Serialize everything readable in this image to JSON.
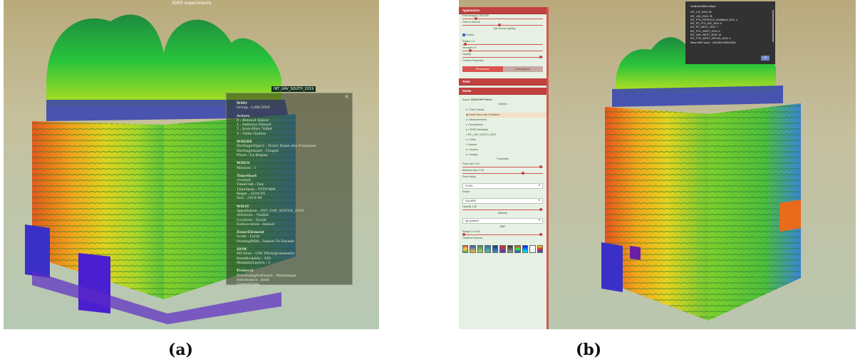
{
  "figure": {
    "caption_a": "(a)",
    "caption_b": "(b)"
  },
  "panel_a": {
    "window_title": "3DRS experiments",
    "node_tag": "INT_UAV_SOUTH_2019",
    "metadata": {
      "close": "×",
      "sections": [
        {
          "heading": "WHO",
          "lines": [
            "Group : LABCENE"
          ]
        },
        {
          "heading": "Actors",
          "lines": [
            "0 : Renaud Séjour",
            "1 : Anthony Pamart",
            "2 : Jean-Marc Vallet",
            "3 : Odile Guillon"
          ]
        },
        {
          "heading": "WHERE",
          "lines": [
            "HeritageObject : Notre Dame des Fontaines",
            "HeritageAsset : Chapel",
            "Place : La Brigue"
          ]
        },
        {
          "heading": "WHEN",
          "lines": [
            "Mission : 1"
          ]
        },
        {
          "heading": "TimeStart",
          "lines": [
            "created : ",
            "TimeUnit : Day",
            "TypeSpan : YYYY-MM",
            "Begin : 2019-05",
            "End : 2019-06"
          ]
        },
        {
          "heading": "WHAT",
          "lines": [
            "Appellation : INT_UAV_SOUTH_2019",
            "Attribute : Visible",
            "Location : South",
            "SubLocation : Indoor"
          ]
        },
        {
          "heading": "Zone/Element",
          "lines": [
            "Scale : Local",
            "OverlapWith : Indoor To Facade"
          ]
        },
        {
          "heading": "HOW",
          "lines": [
            "MCAlias : UAV Photogrammetry",
            "ItemModality : VIS",
            "ModalityLayers : 1"
          ]
        },
        {
          "heading": "Protocol",
          "lines": [
            "ProcessingSoftware : Metashape",
            "Automation : Joint",
            "ContextData"
          ]
        }
      ]
    }
  },
  "panel_b": {
    "sidebar": {
      "appearance": {
        "title": "Appearance",
        "point_budget": "Point budget 2,000,000",
        "fov": "Field of view 60",
        "edl_title": "Eye-Dome-Lighting",
        "enable": "Enable",
        "radius": "Radius 1.4",
        "strength": "Strength 0.4",
        "opacity": "Opacity",
        "camera_projection": "Camera Projection",
        "perspective": "Perspective",
        "orthographic": "Orthographic"
      },
      "tools": {
        "title": "Tools"
      },
      "scene": {
        "title": "Scene",
        "export_label": "Export",
        "formats": [
          "JSON",
          "DXF",
          "Potree"
        ],
        "objects_title": "Objects",
        "tree": [
          "▸ ▪ Point Clouds",
          "   ◉ Notre Dame des Fontaines",
          "▸ ▪ Measurements",
          "▸ ▪ Annotations",
          "▸ ▪ 3DRS Metadata",
          "   ▪ INT_UAV_SOUTH_2019",
          "▸ ▪ Other",
          "   ▪ Camera",
          "▸ ▪ Vectors",
          "▸ ▪ Images"
        ],
        "properties_title": "Properties",
        "point_size": "Point size 2.00",
        "min_size": "Minimum size 2.00",
        "point_sizing": "Point sizing",
        "sizing_value": "FIXED",
        "shape": "Shape",
        "shape_value": "SQUARE",
        "opacity": "Opacity 1.00",
        "attribute_title": "Attribute",
        "attribute_value": "rgb gradient",
        "mnf_title": "MNF",
        "range": "Range 0 to 100",
        "gradient_scheme": "Gradient Scheme",
        "swatch_colors": [
          [
            "#e8524a",
            "#f5d24a",
            "#4caf50"
          ],
          [
            "#3a53c9",
            "#f2c53a"
          ],
          [
            "#3c8f6b",
            "#b3d36b"
          ],
          [
            "#2a6fb0",
            "#57c0a5"
          ],
          [
            "#1d2b86",
            "#4a8fd6"
          ],
          [
            "#d6342b",
            "#4b43b5"
          ],
          [
            "#333333",
            "#999999"
          ],
          [
            "#ff2a2a",
            "#2aff2a",
            "#2a2aff"
          ],
          [
            "#0010ff",
            "#00ffff"
          ],
          [
            "#ffffff",
            "#f0f0f0"
          ],
          [
            "#ffe81a",
            "#e22020",
            "#1a5cff"
          ]
        ]
      }
    },
    "popup": {
      "title": "localhost:8888 indique",
      "lines": [
        "INT_LIG_2018: 59",
        "INT_LSA_2018: 35",
        "INT_PTA_ESCRCCS_MultiBand_2021: 4",
        "INT_RT_PTG_RIS_2019: 8",
        "INT_RT_WEST_2019: 7",
        "INT_PTG_WEST_2019: 6",
        "INT_UAV_WEST_2019: 16",
        "INT_PTG_WEST_ORTHO_2019: 4",
        "Mean MNF score : 136.0812782610944"
      ],
      "ok": "OK"
    }
  }
}
